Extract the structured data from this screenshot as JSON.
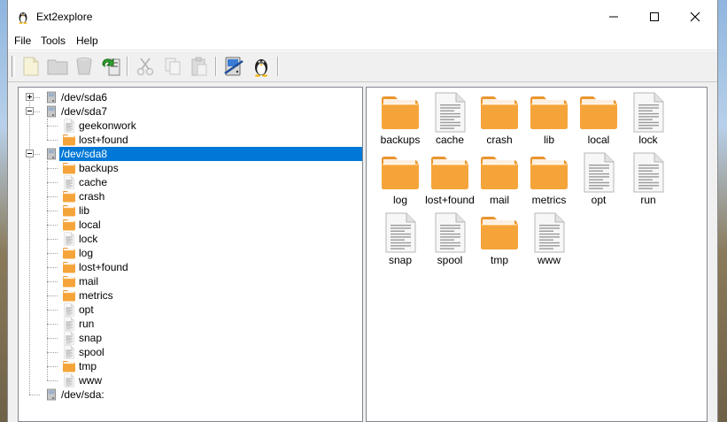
{
  "window": {
    "title": "Ext2explore"
  },
  "menu": [
    {
      "label": "File"
    },
    {
      "label": "Tools"
    },
    {
      "label": "Help"
    }
  ],
  "toolbar": [
    {
      "icon": "new-icon",
      "enabled": false
    },
    {
      "icon": "folder-icon",
      "enabled": false
    },
    {
      "icon": "trash-icon",
      "enabled": false
    },
    {
      "icon": "export-icon",
      "enabled": true
    },
    {
      "icon": "cut-icon",
      "enabled": false
    },
    {
      "icon": "copy-icon",
      "enabled": false
    },
    {
      "icon": "paste-icon",
      "enabled": false
    },
    {
      "icon": "drive-icon",
      "enabled": true
    },
    {
      "icon": "linux-icon",
      "enabled": true
    }
  ],
  "tree": [
    {
      "label": "/dev/sda6",
      "type": "drive",
      "level": 0,
      "expander": "plus"
    },
    {
      "label": "/dev/sda7",
      "type": "drive",
      "level": 0,
      "expander": "minus"
    },
    {
      "label": "geekonwork",
      "type": "file",
      "level": 1
    },
    {
      "label": "lost+found",
      "type": "folder",
      "level": 1
    },
    {
      "label": "/dev/sda8",
      "type": "drive",
      "level": 0,
      "expander": "minus",
      "selected": true
    },
    {
      "label": "backups",
      "type": "folder",
      "level": 1
    },
    {
      "label": "cache",
      "type": "file",
      "level": 1
    },
    {
      "label": "crash",
      "type": "folder",
      "level": 1
    },
    {
      "label": "lib",
      "type": "folder",
      "level": 1
    },
    {
      "label": "local",
      "type": "folder",
      "level": 1
    },
    {
      "label": "lock",
      "type": "file",
      "level": 1
    },
    {
      "label": "log",
      "type": "folder",
      "level": 1
    },
    {
      "label": "lost+found",
      "type": "folder",
      "level": 1
    },
    {
      "label": "mail",
      "type": "folder",
      "level": 1
    },
    {
      "label": "metrics",
      "type": "folder",
      "level": 1
    },
    {
      "label": "opt",
      "type": "file",
      "level": 1
    },
    {
      "label": "run",
      "type": "file",
      "level": 1
    },
    {
      "label": "snap",
      "type": "file",
      "level": 1
    },
    {
      "label": "spool",
      "type": "file",
      "level": 1
    },
    {
      "label": "tmp",
      "type": "folder",
      "level": 1
    },
    {
      "label": "www",
      "type": "file",
      "level": 1
    },
    {
      "label": "/dev/sda:",
      "type": "drive",
      "level": 0
    }
  ],
  "items": [
    {
      "label": "backups",
      "type": "folder"
    },
    {
      "label": "cache",
      "type": "file"
    },
    {
      "label": "crash",
      "type": "folder"
    },
    {
      "label": "lib",
      "type": "folder"
    },
    {
      "label": "local",
      "type": "folder"
    },
    {
      "label": "lock",
      "type": "file"
    },
    {
      "label": "log",
      "type": "folder"
    },
    {
      "label": "lost+found",
      "type": "folder"
    },
    {
      "label": "mail",
      "type": "folder"
    },
    {
      "label": "metrics",
      "type": "folder"
    },
    {
      "label": "opt",
      "type": "file"
    },
    {
      "label": "run",
      "type": "file"
    },
    {
      "label": "snap",
      "type": "file"
    },
    {
      "label": "spool",
      "type": "file"
    },
    {
      "label": "tmp",
      "type": "folder"
    },
    {
      "label": "www",
      "type": "file"
    }
  ],
  "colors": {
    "selection": "#0078d7",
    "folder": "#f5a43a"
  }
}
